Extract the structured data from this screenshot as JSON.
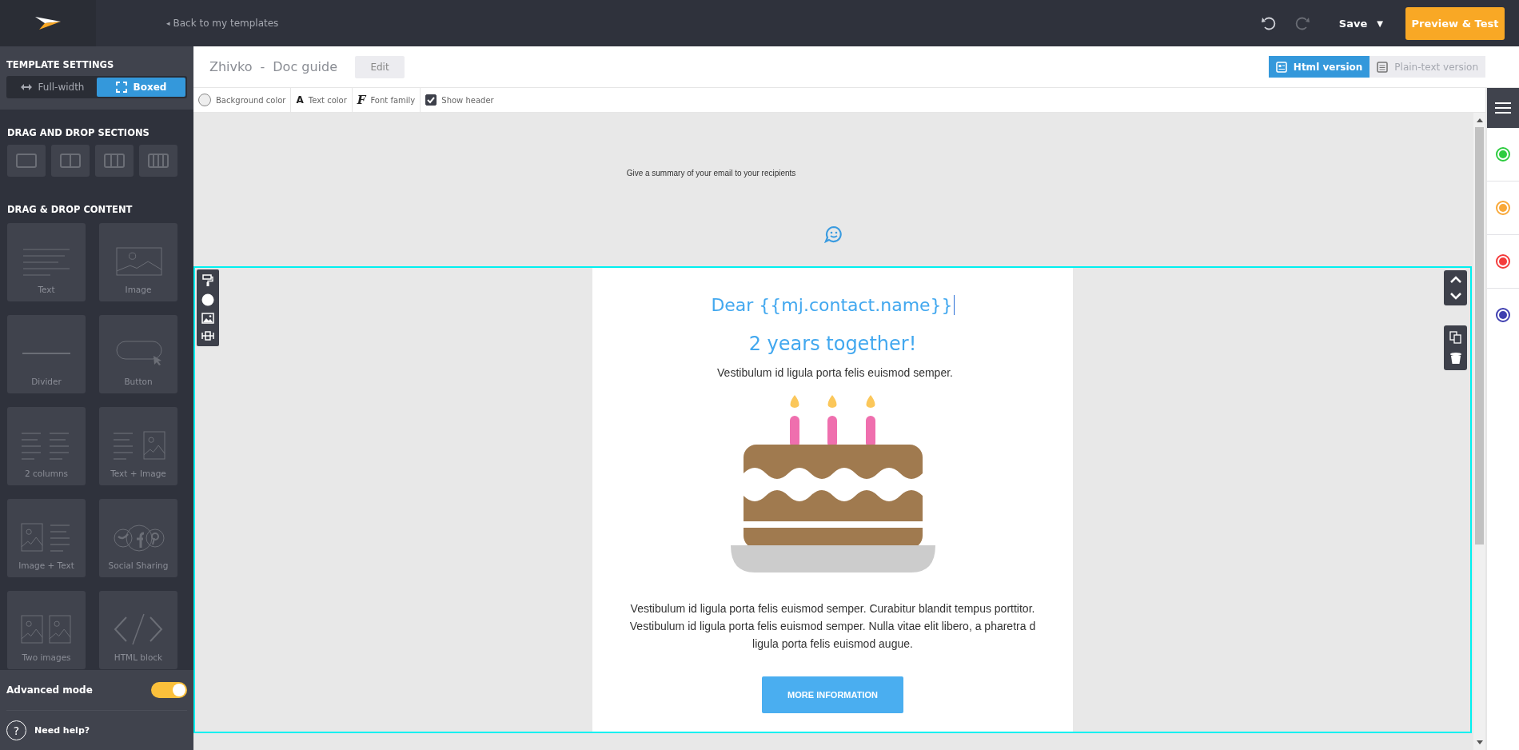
{
  "app_bar": {
    "back_link": {
      "arrow": "◂",
      "label": "Back to my templates"
    },
    "save": {
      "label": "Save",
      "caret": "▼"
    },
    "preview_button": "Preview & Test"
  },
  "sidebar": {
    "template_settings": {
      "title": "TEMPLATE SETTINGS",
      "layouts": [
        {
          "kind": "full",
          "label": "Full-width",
          "selected": false
        },
        {
          "kind": "boxed",
          "label": "Boxed",
          "selected": true
        }
      ]
    },
    "sections": {
      "title": "DRAG AND DROP SECTIONS",
      "blocks": [
        {
          "kind": "one"
        },
        {
          "kind": "two"
        },
        {
          "kind": "three"
        },
        {
          "kind": "four"
        }
      ]
    },
    "content": {
      "title": "DRAG & DROP CONTENT",
      "blocks": [
        {
          "kind": "text",
          "label": "Text"
        },
        {
          "kind": "image",
          "label": "Image"
        },
        {
          "kind": "divider",
          "label": "Divider"
        },
        {
          "kind": "button",
          "label": "Button"
        },
        {
          "kind": "columns",
          "label": "2 columns"
        },
        {
          "kind": "text_image",
          "label": "Text + Image"
        },
        {
          "kind": "image_text",
          "label": "Image + Text"
        },
        {
          "kind": "social",
          "label": "Social Sharing"
        },
        {
          "kind": "two_images",
          "label": "Two images"
        },
        {
          "kind": "html",
          "label": "HTML block"
        }
      ]
    },
    "advanced_mode": {
      "label": "Advanced mode",
      "on": true
    },
    "help": {
      "icon": "?",
      "label": "Need help?"
    }
  },
  "editor": {
    "title": {
      "name": "Zhivko",
      "separator": "-",
      "doc": "Doc guide"
    },
    "edit_button": "Edit",
    "versions": [
      {
        "label": "Html version",
        "selected": true
      },
      {
        "label": "Plain-text version",
        "selected": false
      }
    ],
    "style_tools": [
      {
        "kind": "background",
        "label": "Background color"
      },
      {
        "kind": "text_color",
        "icon": "A",
        "label": "Text color"
      },
      {
        "kind": "font",
        "icon": "F",
        "label": "Font family"
      },
      {
        "kind": "checkbox",
        "label": "Show header",
        "checked": true
      }
    ]
  },
  "email": {
    "preheader": "Give a summary of your email to your recipients",
    "heading": "Dear {{mj.contact.name}}",
    "subheading": "2 years together!",
    "intro": "Vestibulum id ligula porta felis euismod semper.",
    "body_lines": [
      "Vestibulum id ligula porta felis euismod semper. Curabitur blandit tempus porttitor.",
      "Vestibulum id ligula porta felis euismod semper. Nulla vitae elit libero, a pharetra d",
      "ligula porta felis euismod augue."
    ],
    "button": "MORE INFORMATION"
  },
  "right_panel": {
    "markers": [
      {
        "color": "#2ecc40"
      },
      {
        "color": "#f9a838"
      },
      {
        "color": "#f43b3b"
      },
      {
        "color": "#3f3fb0"
      }
    ]
  }
}
